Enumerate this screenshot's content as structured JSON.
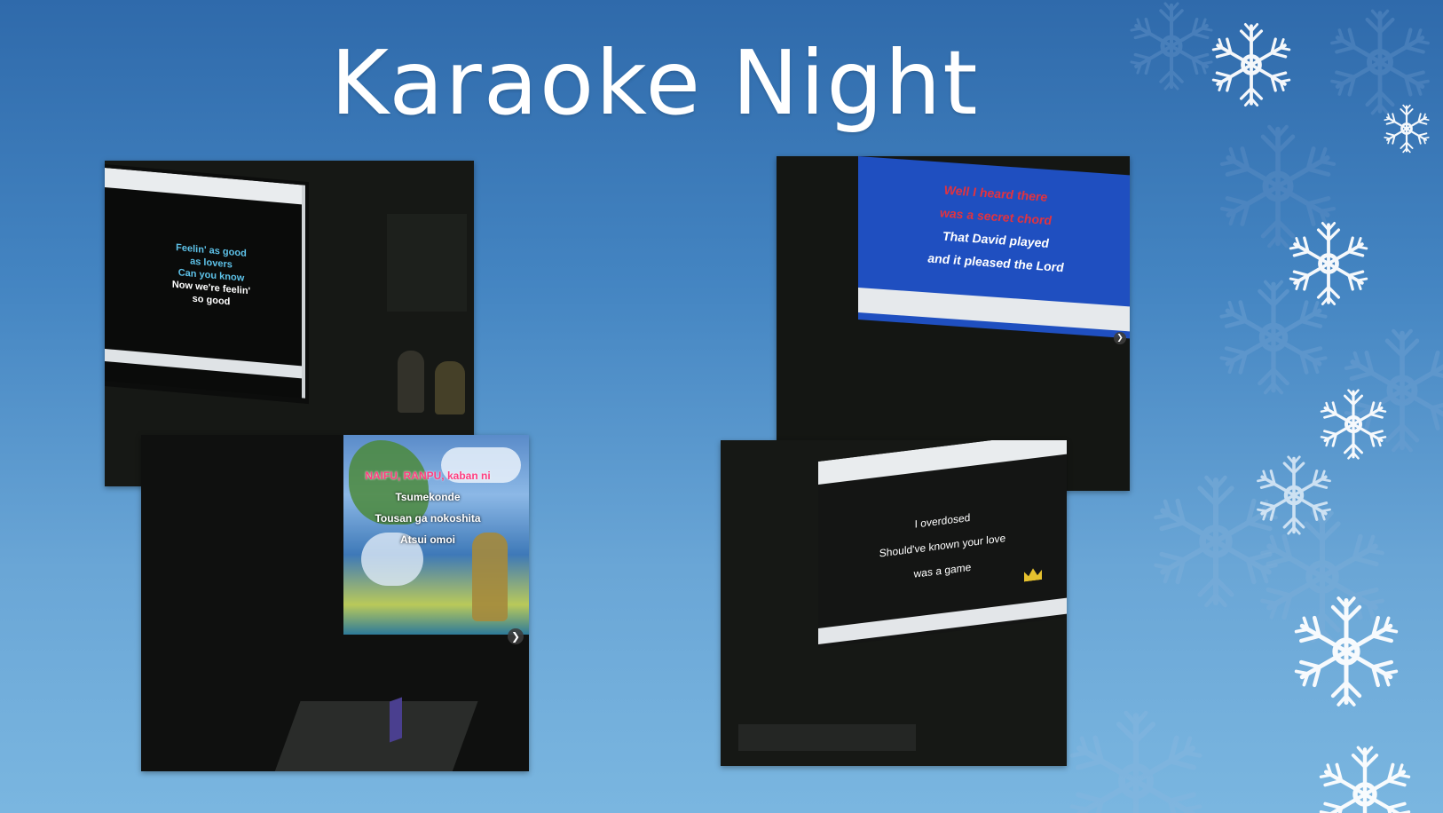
{
  "slide": {
    "title": "Karaoke Night"
  },
  "photos": {
    "top_left": {
      "lyrics": [
        "Feelin'  as good",
        "as lovers",
        "Can you know",
        "Now we're feelin'",
        "so good"
      ]
    },
    "top_right": {
      "lyrics": [
        "Well I heard there",
        "was a secret chord",
        "That David played",
        "and it pleased the Lord"
      ]
    },
    "bottom_left": {
      "lyrics": [
        "NAIFU, RANPU, kaban ni",
        "Tsumekonde",
        "Tousan ga nokoshita",
        "Atsui omoi"
      ]
    },
    "bottom_right": {
      "lyrics": [
        "I overdosed",
        "Should've known your love",
        "was a game"
      ]
    }
  },
  "colors": {
    "bg_top": "#2f6aab",
    "bg_bottom": "#7ab6e0",
    "lyric_blue": "#5ec3ea",
    "lyric_red": "#e2333f",
    "screen_blue": "#1f4fc0"
  },
  "icons": [
    "snowflake-icon",
    "chevron-right-icon"
  ]
}
